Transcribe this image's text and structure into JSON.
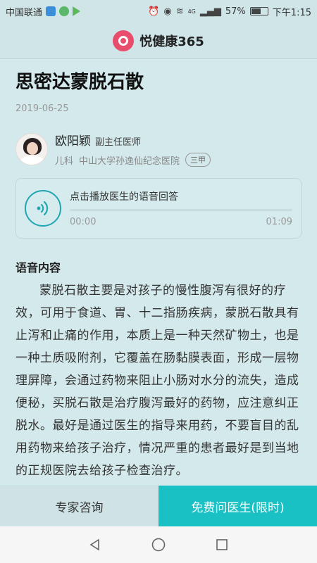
{
  "status_bar": {
    "carrier": "中国联通",
    "signal_label": "4G",
    "battery_percent": "57%",
    "time": "下午1:15"
  },
  "header": {
    "app_name": "悦健康365",
    "logo_color": "#e84d6c"
  },
  "article": {
    "title": "思密达蒙脱石散",
    "date": "2019-06-25"
  },
  "doctor": {
    "name": "欧阳颖",
    "rank": "副主任医师",
    "department": "儿科",
    "hospital": "中山大学孙逸仙纪念医院",
    "grade": "三甲"
  },
  "audio": {
    "label": "点击播放医生的语音回答",
    "current_time": "00:00",
    "duration": "01:09",
    "progress": 0
  },
  "section": {
    "title": "语音内容",
    "body": "蒙脱石散主要是对孩子的慢性腹泻有很好的疗效，可用于食道、胃、十二指肠疾病，蒙脱石散具有止泻和止痛的作用，本质上是一种天然矿物土，也是一种土质吸附剂，它覆盖在肠黏膜表面，形成一层物理屏障，会通过药物来阻止小肠对水分的流失，造成便秘，买脱石散是治疗腹泻最好的药物，应注意纠正脱水。最好是通过医生的指导来用药，不要盲目的乱用药物来给孩子治疗，情况严重的患者最好是到当地的正规医院去给孩子检查治疗。"
  },
  "bottom_bar": {
    "consult_label": "专家咨询",
    "free_ask_label": "免费问医生(限时)",
    "accent_color": "#19c1c4"
  },
  "nav_bar": {
    "icons": [
      "back-icon",
      "home-icon",
      "recents-icon"
    ]
  }
}
